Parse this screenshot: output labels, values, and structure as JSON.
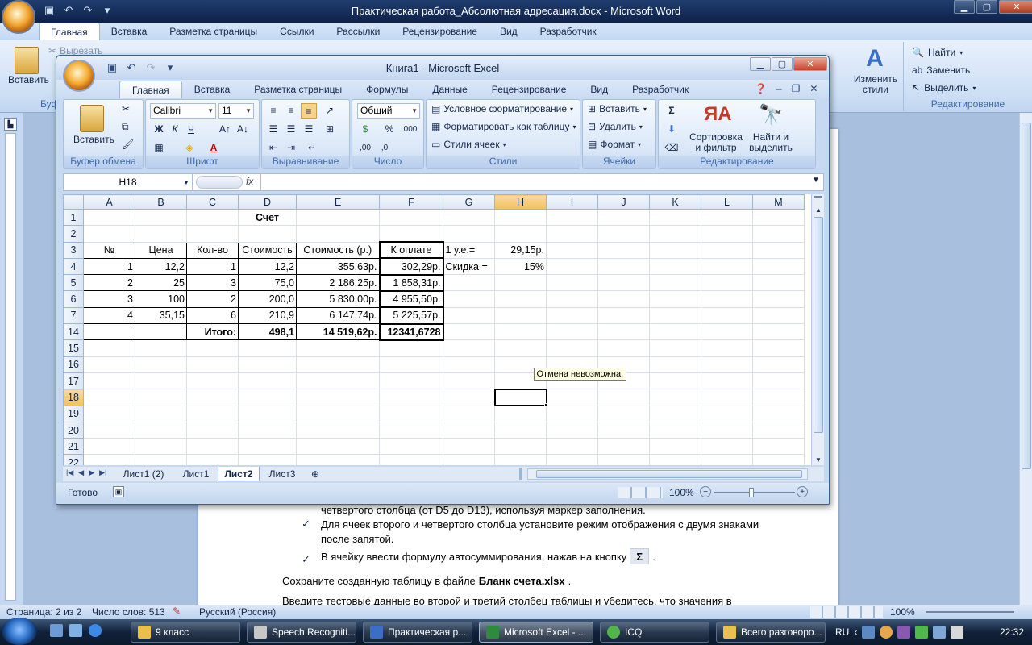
{
  "word": {
    "title": "Практическая работа_Абсолютная адресация.docx - Microsoft Word",
    "tabs": [
      "Главная",
      "Вставка",
      "Разметка страницы",
      "Ссылки",
      "Рассылки",
      "Рецензирование",
      "Вид",
      "Разработчик"
    ],
    "left_ribbon": {
      "paste": "Вставить",
      "cut": "Вырезать",
      "buffer": "Буф"
    },
    "right_ribbon": {
      "change_styles": "Изменить стили",
      "find": "Найти",
      "replace": "Заменить",
      "select": "Выделить",
      "group": "Редактирование"
    },
    "doc_lines": [
      "четвертого столбца (от D5 до D13), используя маркер заполнения.",
      "Для ячеек второго и четвертого столбца установите режим отображения с двумя знаками",
      "после запятой.",
      "В ячейку ввести формулу автосуммирования, нажав на кнопку",
      "Сохраните созданную таблицу в файле",
      "Бланк счета.xlsx",
      "Введите тестовые данные во второй и третий столбец таблицы и убедитесь, что значения в"
    ],
    "status": {
      "page": "Страница: 2 из 2",
      "words": "Число слов: 513",
      "lang": "Русский (Россия)",
      "zoom": "100%"
    }
  },
  "excel": {
    "title": "Книга1 - Microsoft Excel",
    "tabs": [
      "Главная",
      "Вставка",
      "Разметка страницы",
      "Формулы",
      "Данные",
      "Рецензирование",
      "Вид",
      "Разработчик"
    ],
    "ribbon": {
      "paste": "Вставить",
      "clipboard": "Буфер обмена",
      "font_name": "Calibri",
      "font_size": "11",
      "font": "Шрифт",
      "alignment": "Выравнивание",
      "number_format": "Общий",
      "number": "Число",
      "cond_format": "Условное форматирование",
      "format_table": "Форматировать как таблицу",
      "cell_styles": "Стили ячеек",
      "styles": "Стили",
      "insert": "Вставить",
      "delete": "Удалить",
      "format": "Формат",
      "cells": "Ячейки",
      "sort_filter": "Сортировка и фильтр",
      "find_select": "Найти и выделить",
      "editing": "Редактирование",
      "bold": "Ж",
      "italic": "К",
      "underline": "Ч",
      "percent": "%",
      "thousands": "000"
    },
    "name_box": "H18",
    "fx": "fx",
    "columns": [
      "A",
      "B",
      "C",
      "D",
      "E",
      "F",
      "G",
      "H",
      "I",
      "J",
      "K",
      "L",
      "M"
    ],
    "rows": [
      {
        "n": "1",
        "cells": [
          "",
          "",
          "",
          "Счет",
          "",
          "",
          "",
          "",
          "",
          "",
          "",
          "",
          ""
        ]
      },
      {
        "n": "2",
        "cells": [
          "",
          "",
          "",
          "",
          "",
          "",
          "",
          "",
          "",
          "",
          "",
          "",
          ""
        ]
      },
      {
        "n": "3",
        "cells": [
          "№",
          "Цена",
          "Кол-во",
          "Стоимость",
          "Стоимость (р.)",
          "К оплате",
          "1 у.е.=",
          "29,15р.",
          "",
          "",
          "",
          "",
          ""
        ]
      },
      {
        "n": "4",
        "cells": [
          "1",
          "12,2",
          "1",
          "12,2",
          "355,63р.",
          "302,29р.",
          "Скидка =",
          "15%",
          "",
          "",
          "",
          "",
          ""
        ]
      },
      {
        "n": "5",
        "cells": [
          "2",
          "25",
          "3",
          "75,0",
          "2 186,25р.",
          "1 858,31р.",
          "",
          "",
          "",
          "",
          "",
          "",
          ""
        ]
      },
      {
        "n": "6",
        "cells": [
          "3",
          "100",
          "2",
          "200,0",
          "5 830,00р.",
          "4 955,50р.",
          "",
          "",
          "",
          "",
          "",
          "",
          ""
        ]
      },
      {
        "n": "7",
        "cells": [
          "4",
          "35,15",
          "6",
          "210,9",
          "6 147,74р.",
          "5 225,57р.",
          "",
          "",
          "",
          "",
          "",
          "",
          ""
        ]
      },
      {
        "n": "14",
        "cells": [
          "",
          "",
          "Итого:",
          "498,1",
          "14 519,62р.",
          "12341,6728",
          "",
          "",
          "",
          "",
          "",
          "",
          ""
        ]
      },
      {
        "n": "15",
        "cells": [
          "",
          "",
          "",
          "",
          "",
          "",
          "",
          "",
          "",
          "",
          "",
          "",
          ""
        ]
      },
      {
        "n": "16",
        "cells": [
          "",
          "",
          "",
          "",
          "",
          "",
          "",
          "",
          "",
          "",
          "",
          "",
          ""
        ]
      },
      {
        "n": "17",
        "cells": [
          "",
          "",
          "",
          "",
          "",
          "",
          "",
          "",
          "",
          "",
          "",
          "",
          ""
        ]
      },
      {
        "n": "18",
        "cells": [
          "",
          "",
          "",
          "",
          "",
          "",
          "",
          "",
          "",
          "",
          "",
          "",
          ""
        ]
      },
      {
        "n": "19",
        "cells": [
          "",
          "",
          "",
          "",
          "",
          "",
          "",
          "",
          "",
          "",
          "",
          "",
          ""
        ]
      },
      {
        "n": "20",
        "cells": [
          "",
          "",
          "",
          "",
          "",
          "",
          "",
          "",
          "",
          "",
          "",
          "",
          ""
        ]
      },
      {
        "n": "21",
        "cells": [
          "",
          "",
          "",
          "",
          "",
          "",
          "",
          "",
          "",
          "",
          "",
          "",
          ""
        ]
      },
      {
        "n": "22",
        "cells": [
          "",
          "",
          "",
          "",
          "",
          "",
          "",
          "",
          "",
          "",
          "",
          "",
          ""
        ]
      }
    ],
    "tooltip": "Отмена невозможна.",
    "sheet_tabs": [
      "Лист1 (2)",
      "Лист1",
      "Лист2",
      "Лист3"
    ],
    "active_sheet": "Лист2",
    "status": {
      "ready": "Готово",
      "zoom": "100%"
    }
  },
  "taskbar": {
    "items": [
      "9 класс",
      "Speech Recogniti...",
      "Практическая р...",
      "Microsoft Excel - ...",
      "ICQ",
      "Всего разговоро..."
    ],
    "lang": "RU",
    "clock": "22:32"
  }
}
